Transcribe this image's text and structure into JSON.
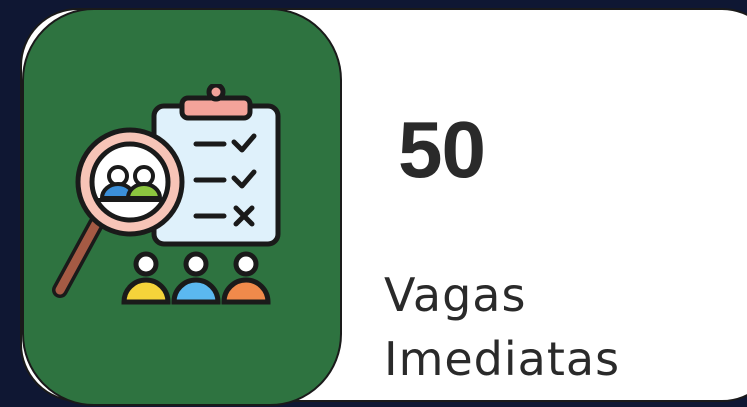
{
  "stat": {
    "value": "50",
    "label_line1": "Vagas",
    "label_line2": "Imediatas"
  },
  "icon": {
    "name": "recruitment-search-icon"
  },
  "colors": {
    "background": "#0f1733",
    "card": "#ffffff",
    "icon_panel": "#2e7340",
    "text": "#2a2a2a"
  }
}
